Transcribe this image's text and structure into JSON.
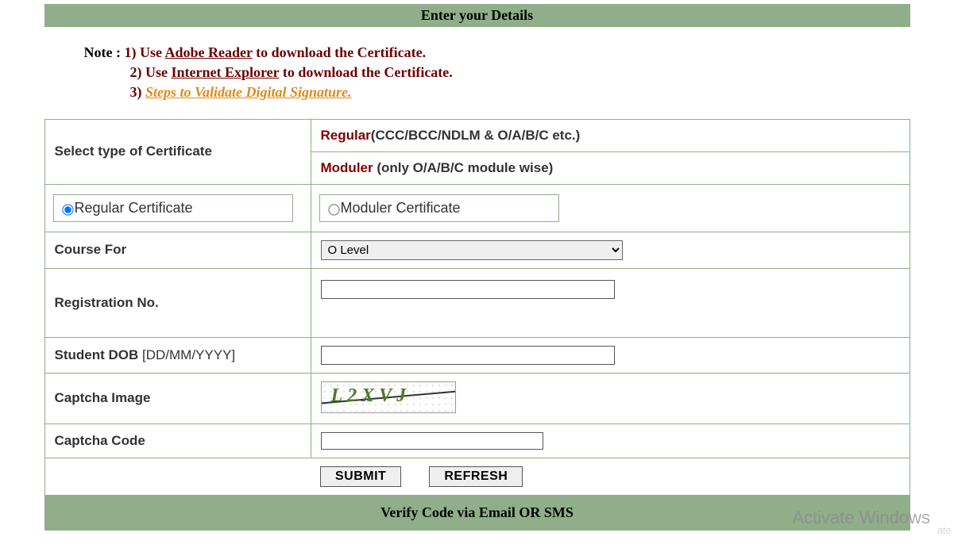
{
  "header": {
    "title": "Enter your Details"
  },
  "notes": {
    "label": "Note :",
    "items": [
      {
        "num": "1)",
        "prefix": "Use ",
        "link": "Adobe Reader",
        "suffix": " to download the Certificate."
      },
      {
        "num": "2)",
        "prefix": "Use ",
        "link": "Internet Explorer",
        "suffix": " to download the Certificate."
      },
      {
        "num": "3)",
        "prefix": "",
        "link": "Steps to Validate Digital Signature.",
        "suffix": ""
      }
    ]
  },
  "form": {
    "select_type_label": "Select type of Certificate",
    "regular_row_prefix": "Regular",
    "regular_row_suffix": "(CCC/BCC/NDLM & O/A/B/C etc.)",
    "moduler_row_prefix": "Moduler ",
    "moduler_row_suffix": "(only O/A/B/C module wise)",
    "radio_regular": "Regular Certificate",
    "radio_moduler": "Moduler Certificate",
    "course_for_label": "Course For",
    "course_options": [
      "O Level"
    ],
    "course_selected": "O Level",
    "registration_label": "Registration No.",
    "registration_value": "",
    "dob_label": "Student DOB",
    "dob_format": " [DD/MM/YYYY]",
    "dob_value": "",
    "captcha_image_label": "Captcha Image",
    "captcha_text": "L2XVJ",
    "captcha_code_label": "Captcha Code",
    "captcha_code_value": "",
    "submit_btn": "SUBMIT",
    "refresh_btn": "REFRESH"
  },
  "footer": {
    "title": "Verify Code via Email OR SMS"
  },
  "watermark": {
    "line1": "Activate Windows",
    "line2": "ate Wind"
  }
}
